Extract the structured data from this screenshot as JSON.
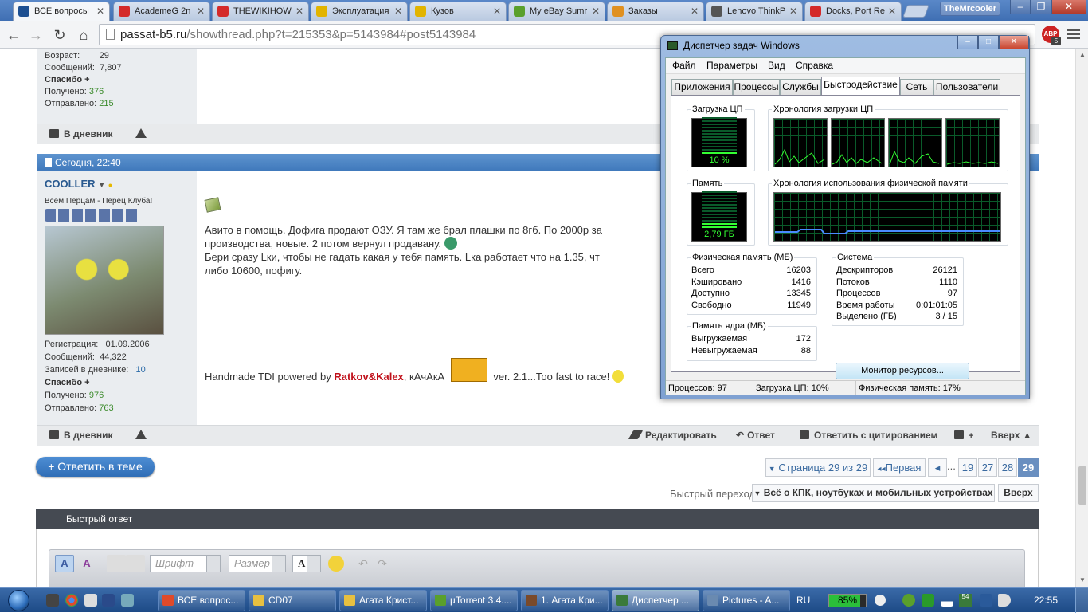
{
  "browser": {
    "tabs": [
      {
        "label": "ВСЕ вопросы",
        "icon": "vw-logo-icon",
        "color": "#1d4f91",
        "active": true
      },
      {
        "label": "AcademeG 2n",
        "icon": "youtube-icon",
        "color": "#d42a2a"
      },
      {
        "label": "THEWIKIHOW",
        "icon": "youtube-icon",
        "color": "#d42a2a"
      },
      {
        "label": "Эксплуатация",
        "icon": "star-icon",
        "color": "#e2b400"
      },
      {
        "label": "Кузов",
        "icon": "star-icon",
        "color": "#e2b400"
      },
      {
        "label": "My eBay Sumr",
        "icon": "ebay-icon",
        "color": "#5aa02c"
      },
      {
        "label": "Заказы",
        "icon": "ie-icon",
        "color": "#e09020"
      },
      {
        "label": "Lenovo ThinkP",
        "icon": "gear-icon",
        "color": "#555555"
      },
      {
        "label": "Docks, Port Re",
        "icon": "letter-l-icon",
        "color": "#d42a2a"
      }
    ],
    "profile": "TheMrcooler",
    "url_host": "passat-b5.ru",
    "url_path": "/showthread.php?t=215353&p=5143984#post5143984",
    "abp_label": "ABP",
    "abp_count": "5"
  },
  "forum": {
    "prev_user": {
      "age_label": "Возраст:",
      "age": "29",
      "msgs_label": "Сообщений:",
      "msgs": "7,807",
      "thanks": "Спасибо +",
      "recv_label": "Получено:",
      "recv": "376",
      "sent_label": "Отправлено:",
      "sent": "215"
    },
    "diary_btn": "В дневник",
    "post_date": "Сегодня, 22:40",
    "user": {
      "name": "COOLLER",
      "title": "Всем Перцам - Перец Клуба!",
      "reg_label": "Регистрация:",
      "reg": "01.09.2006",
      "msgs_label": "Сообщений:",
      "msgs": "44,322",
      "diary_label": "Записей в дневнике:",
      "diary": "10",
      "thanks": "Спасибо +",
      "recv_label": "Получено:",
      "recv": "976",
      "sent_label": "Отправлено:",
      "sent": "763"
    },
    "message": {
      "line1": "Авито в помощь. Дофига продают ОЗУ. Я там же брал плашки по 8гб. По 2000р за",
      "line2": "производства, новые. 2 потом вернул продавану.",
      "line3": "Бери сразу Lки, чтобы не гадать какая у тебя память. Lка работает что на 1.35, чт",
      "line4": "либо 10600, пофигу."
    },
    "signature": {
      "pre": "Handmade TDI powered by ",
      "brand": "Ratkov&Kalex",
      "mid": ", кАчАкА",
      "post": " ver. 2.1...Too fast to race!"
    },
    "actions": {
      "edit": "Редактировать",
      "reply": "Ответ",
      "quote": "Ответить с цитированием",
      "top": "Вверх"
    },
    "reply_thread": "+ Ответить в теме",
    "pagination": {
      "info": "Страница 29 из 29",
      "first": "Первая",
      "prev": "◂",
      "dots": "...",
      "pages": [
        "19",
        "27",
        "28",
        "29"
      ],
      "current": "29"
    },
    "quick_nav_label": "Быстрый переход",
    "quick_nav_value": "Всё о КПК, ноутбуках и мобильных устройствах",
    "quick_nav_top": "Вверх",
    "quick_reply": "Быстрый ответ",
    "editor": {
      "font_placeholder": "Шрифт",
      "size_placeholder": "Размер"
    }
  },
  "taskmgr": {
    "title": "Диспетчер задач Windows",
    "menu": [
      "Файл",
      "Параметры",
      "Вид",
      "Справка"
    ],
    "tabs": [
      "Приложения",
      "Процессы",
      "Службы",
      "Быстродействие",
      "Сеть",
      "Пользователи"
    ],
    "active_tab": "Быстродействие",
    "cpu_label": "Загрузка ЦП",
    "cpu_value": "10 %",
    "cpu_hist_label": "Хронология загрузки ЦП",
    "mem_label": "Память",
    "mem_value": "2,79 ГБ",
    "mem_hist_label": "Хронология использования физической памяти",
    "phys": {
      "label": "Физическая память (МБ)",
      "rows": [
        {
          "k": "Всего",
          "v": "16203"
        },
        {
          "k": "Кэшировано",
          "v": "1416"
        },
        {
          "k": "Доступно",
          "v": "13345"
        },
        {
          "k": "Свободно",
          "v": "11949"
        }
      ]
    },
    "kernel": {
      "label": "Память ядра (МБ)",
      "rows": [
        {
          "k": "Выгружаемая",
          "v": "172"
        },
        {
          "k": "Невыгружаемая",
          "v": "88"
        }
      ]
    },
    "system": {
      "label": "Система",
      "rows": [
        {
          "k": "Дескрипторов",
          "v": "26121"
        },
        {
          "k": "Потоков",
          "v": "1110"
        },
        {
          "k": "Процессов",
          "v": "97"
        },
        {
          "k": "Время работы",
          "v": "0:01:01:05"
        },
        {
          "k": "Выделено (ГБ)",
          "v": "3 / 15"
        }
      ]
    },
    "resource_btn": "Монитор ресурсов...",
    "status": {
      "procs": "Процессов: 97",
      "cpu": "Загрузка ЦП: 10%",
      "mem": "Физическая память: 17%"
    },
    "cpu_level": 0.1,
    "mem_level": 0.17
  },
  "taskbar": {
    "items": [
      {
        "label": "ВСЕ вопрос...",
        "icon": "chrome-icon",
        "color": "#e04a2a"
      },
      {
        "label": "CD07",
        "icon": "folder-icon",
        "color": "#e8c040"
      },
      {
        "label": "Агата Крист...",
        "icon": "folder-icon",
        "color": "#e8c040"
      },
      {
        "label": "µTorrent 3.4....",
        "icon": "utorrent-icon",
        "color": "#5aa02c"
      },
      {
        "label": "1. Агата Кри...",
        "icon": "media-icon",
        "color": "#7a4a2a"
      },
      {
        "label": "Диспетчер ...",
        "icon": "taskmgr-icon",
        "color": "#3a7a3a",
        "active": true
      },
      {
        "label": "Pictures - A...",
        "icon": "pictures-icon",
        "color": "#6a8ab0"
      }
    ],
    "lang": "RU",
    "battery": "85%",
    "cpu_badge": "54",
    "time": "22:55"
  }
}
